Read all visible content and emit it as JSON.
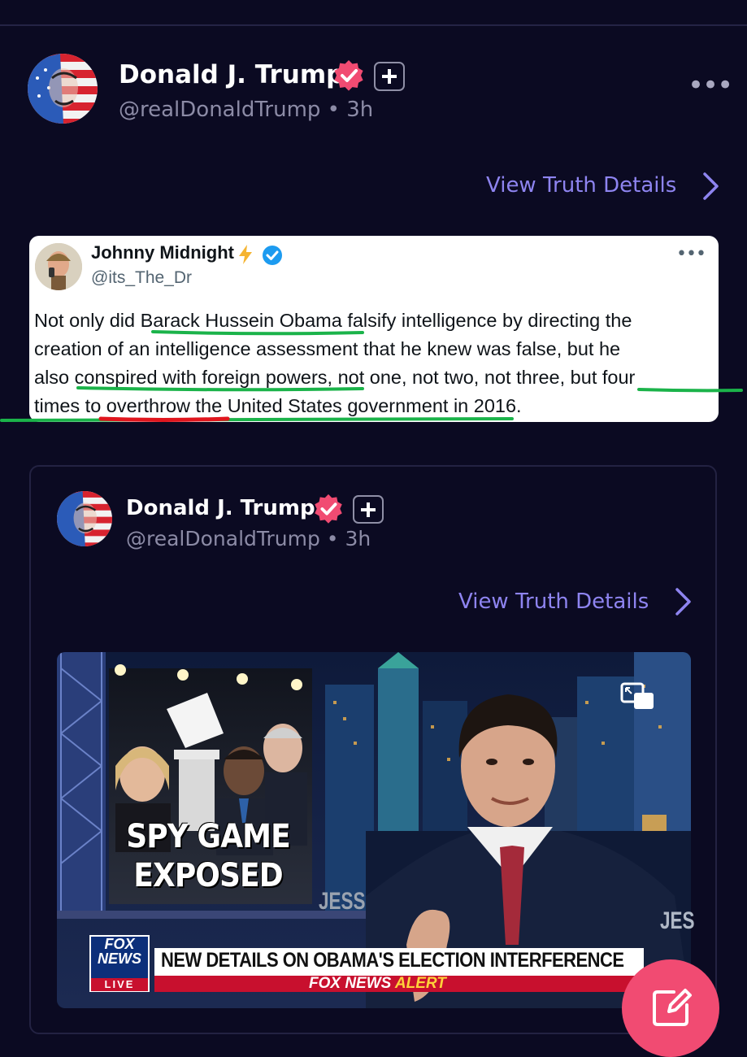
{
  "post": {
    "author_name": "Donald J. Trump",
    "handle_time": "@realDonaldTrump • 3h",
    "view_details_label": "View Truth Details"
  },
  "quoted_tweet": {
    "author_name": "Johnny Midnight",
    "handle": "@its_The_Dr",
    "text_lines": [
      "Not only did Barack Hussein Obama falsify intelligence by directing the",
      "creation of an intelligence assessment that he knew was false, but he",
      "also conspired with foreign powers, not one, not two, not three, but four",
      "times to overthrow the United States government in 2016."
    ]
  },
  "embedded_post": {
    "author_name": "Donald J. Trump",
    "handle_time": "@realDonaldTrump • 3h",
    "view_details_label": "View Truth Details"
  },
  "video": {
    "graphic_text_line1": "SPY GAME",
    "graphic_text_line2": "EXPOSED",
    "set_text_left": "JESS",
    "set_text_right": "JES",
    "network_top": "FOX",
    "network_bottom": "NEWS",
    "network_live": "LIVE",
    "headline": "NEW DETAILS ON OBAMA'S ELECTION INTERFERENCE",
    "alert_brand": "FOX NEWS",
    "alert_word": "ALERT"
  },
  "colors": {
    "background": "#0b0a22",
    "accent_link": "#8e84f0",
    "verified_badge": "#f14b72",
    "compose_button": "#f14b72",
    "underline_green": "#1bb34a",
    "underline_red": "#e0161e"
  },
  "icons": {
    "verified": "verified-badge-icon",
    "plus": "plus-badge-icon",
    "more": "more-options-icon",
    "chevron": "chevron-right-icon",
    "pip": "picture-in-picture-icon",
    "compose": "compose-icon"
  }
}
